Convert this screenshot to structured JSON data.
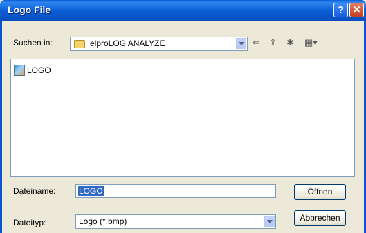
{
  "window": {
    "title": "Logo File",
    "help_icon": "?",
    "close_icon": "✕"
  },
  "toolbar": {
    "look_in_label": "Suchen in:",
    "look_in_value": "elproLOG ANALYZE",
    "back_icon": "⇐",
    "up_icon": "⇧",
    "new_folder_icon": "✱",
    "view_icon": "▦▾"
  },
  "files": [
    {
      "name": "LOGO",
      "icon": "bitmap-file-icon"
    }
  ],
  "filename": {
    "label": "Dateiname:",
    "value": "LOGO"
  },
  "filetype": {
    "label": "Dateityp:",
    "value": "Logo (*.bmp)"
  },
  "buttons": {
    "open": "Öffnen",
    "cancel": "Abbrechen"
  }
}
